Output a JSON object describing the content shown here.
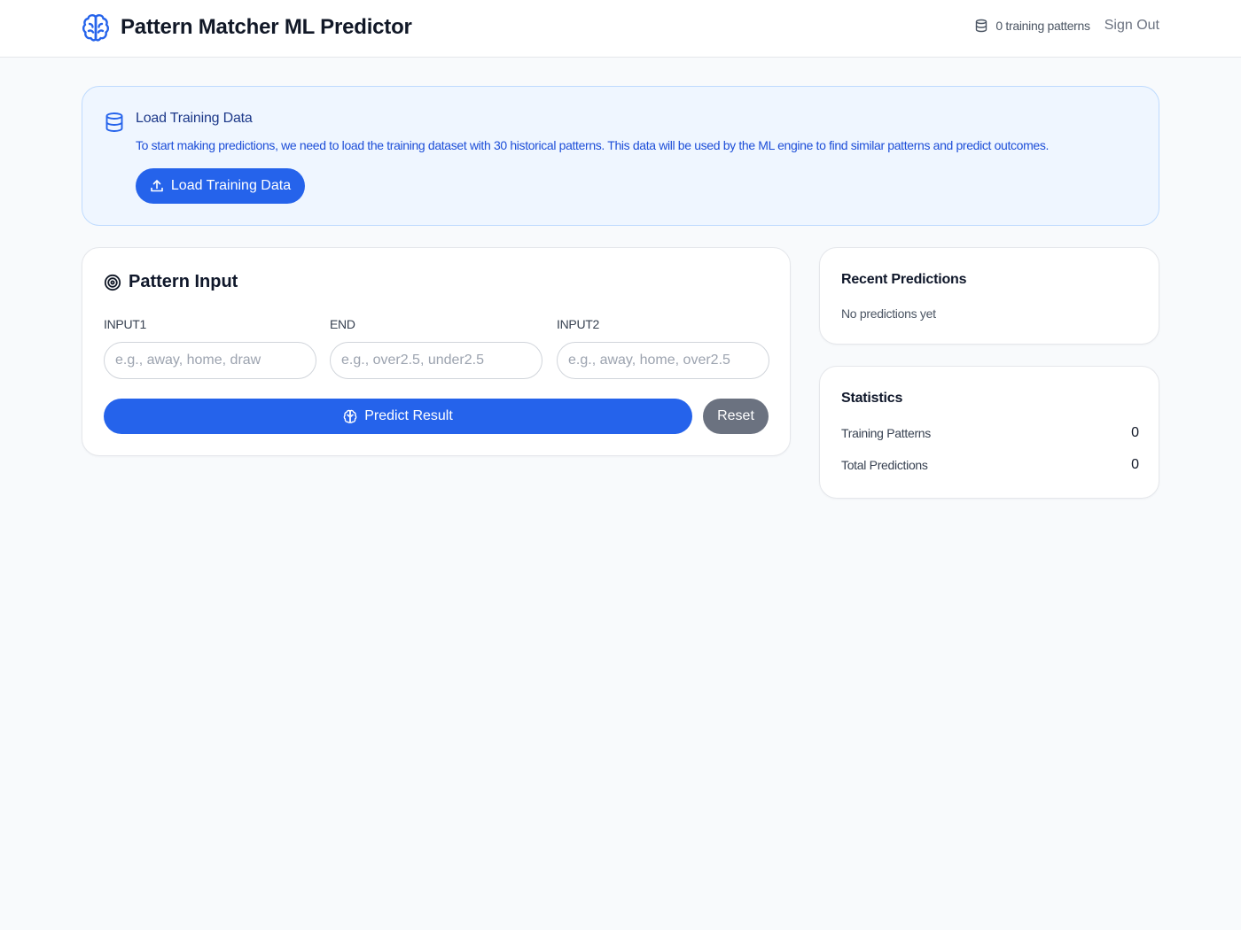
{
  "header": {
    "title": "Pattern Matcher ML Predictor",
    "patterns_status": "0 training patterns",
    "sign_out": "Sign Out",
    "brand_icon": "brain-icon",
    "accent_color": "#2563eb"
  },
  "alert": {
    "icon": "database-icon",
    "title": "Load Training Data",
    "text": "To start making predictions, we need to load the training dataset with 30 historical patterns. This data will be used by the ML engine to find similar patterns and predict outcomes.",
    "button_label": "Load Training Data",
    "button_icon": "upload-icon"
  },
  "pattern_input": {
    "title": "Pattern Input",
    "title_icon": "target-icon",
    "fields": [
      {
        "label": "INPUT1",
        "value": "",
        "placeholder": "e.g., away, home, draw"
      },
      {
        "label": "END",
        "value": "",
        "placeholder": "e.g., over2.5, under2.5"
      },
      {
        "label": "INPUT2",
        "value": "",
        "placeholder": "e.g., away, home, over2.5"
      }
    ],
    "predict_label": "Predict Result",
    "predict_icon": "brain-icon",
    "reset_label": "Reset"
  },
  "recent_predictions": {
    "title": "Recent Predictions",
    "empty_text": "No predictions yet"
  },
  "statistics": {
    "title": "Statistics",
    "rows": [
      {
        "label": "Training Patterns",
        "value": "0"
      },
      {
        "label": "Total Predictions",
        "value": "0"
      }
    ]
  }
}
